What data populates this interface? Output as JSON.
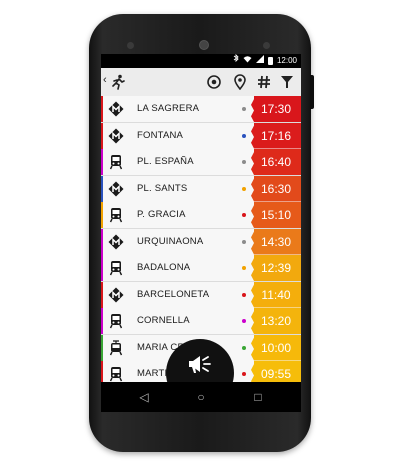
{
  "status_bar": {
    "time": "12:00",
    "icons": [
      "bluetooth-icon",
      "wifi-icon",
      "signal-icon",
      "battery-icon"
    ]
  },
  "toolbar": {
    "back_symbol": "‹",
    "icons": [
      "runner-icon",
      "target-icon",
      "location-pin-icon",
      "hashtag-icon",
      "filter-icon"
    ]
  },
  "stations": [
    {
      "name": "LA SAGRERA",
      "type": "metro",
      "line_color": "#8c8c8c",
      "time": "17:30",
      "time_bg": "#d9161b"
    },
    {
      "name": "FONTANA",
      "type": "metro",
      "line_color": "#2a52be",
      "time": "17:16",
      "time_bg": "#db1c1c"
    },
    {
      "name": "PL. ESPAÑA",
      "type": "train",
      "line_color": "#8c8c8c",
      "time": "16:40",
      "time_bg": "#de2a1a"
    },
    {
      "name": "PL. SANTS",
      "type": "metro",
      "line_color": "#f2a200",
      "time": "16:30",
      "time_bg": "#e24a1b"
    },
    {
      "name": "P. GRACIA",
      "type": "train",
      "line_color": "#d9161b",
      "time": "15:10",
      "time_bg": "#e65a1a"
    },
    {
      "name": "URQUINAONA",
      "type": "metro",
      "line_color": "#8c8c8c",
      "time": "14:30",
      "time_bg": "#ea7a1a"
    },
    {
      "name": "BADALONA",
      "type": "train",
      "line_color": "#f2a200",
      "time": "12:39",
      "time_bg": "#f2a90e"
    },
    {
      "name": "BARCELONETA",
      "type": "metro",
      "line_color": "#d9161b",
      "time": "11:40",
      "time_bg": "#f4ae0c"
    },
    {
      "name": "CORNELLA",
      "type": "train",
      "line_color": "#cc00cc",
      "time": "13:20",
      "time_bg": "#f4b40c"
    },
    {
      "name": "MARIA CRISTINA",
      "type": "tram",
      "line_color": "#3aa635",
      "time": "10:00",
      "time_bg": "#f6b90a"
    },
    {
      "name": "MARTI",
      "type": "train",
      "line_color": "#d9161b",
      "time": "09:55",
      "time_bg": "#f6bd0a"
    }
  ],
  "left_strip_colors": [
    "#d9161b",
    "#d9161b",
    "#cc00cc",
    "#2a52be",
    "#f2a200",
    "#cc00cc",
    "#cc00cc",
    "#d9161b",
    "#cc00cc",
    "#3aa635",
    "#d9161b"
  ],
  "fab": {
    "icon": "megaphone-icon"
  },
  "nav": {
    "back": "◁",
    "home": "○",
    "recents": "□"
  }
}
